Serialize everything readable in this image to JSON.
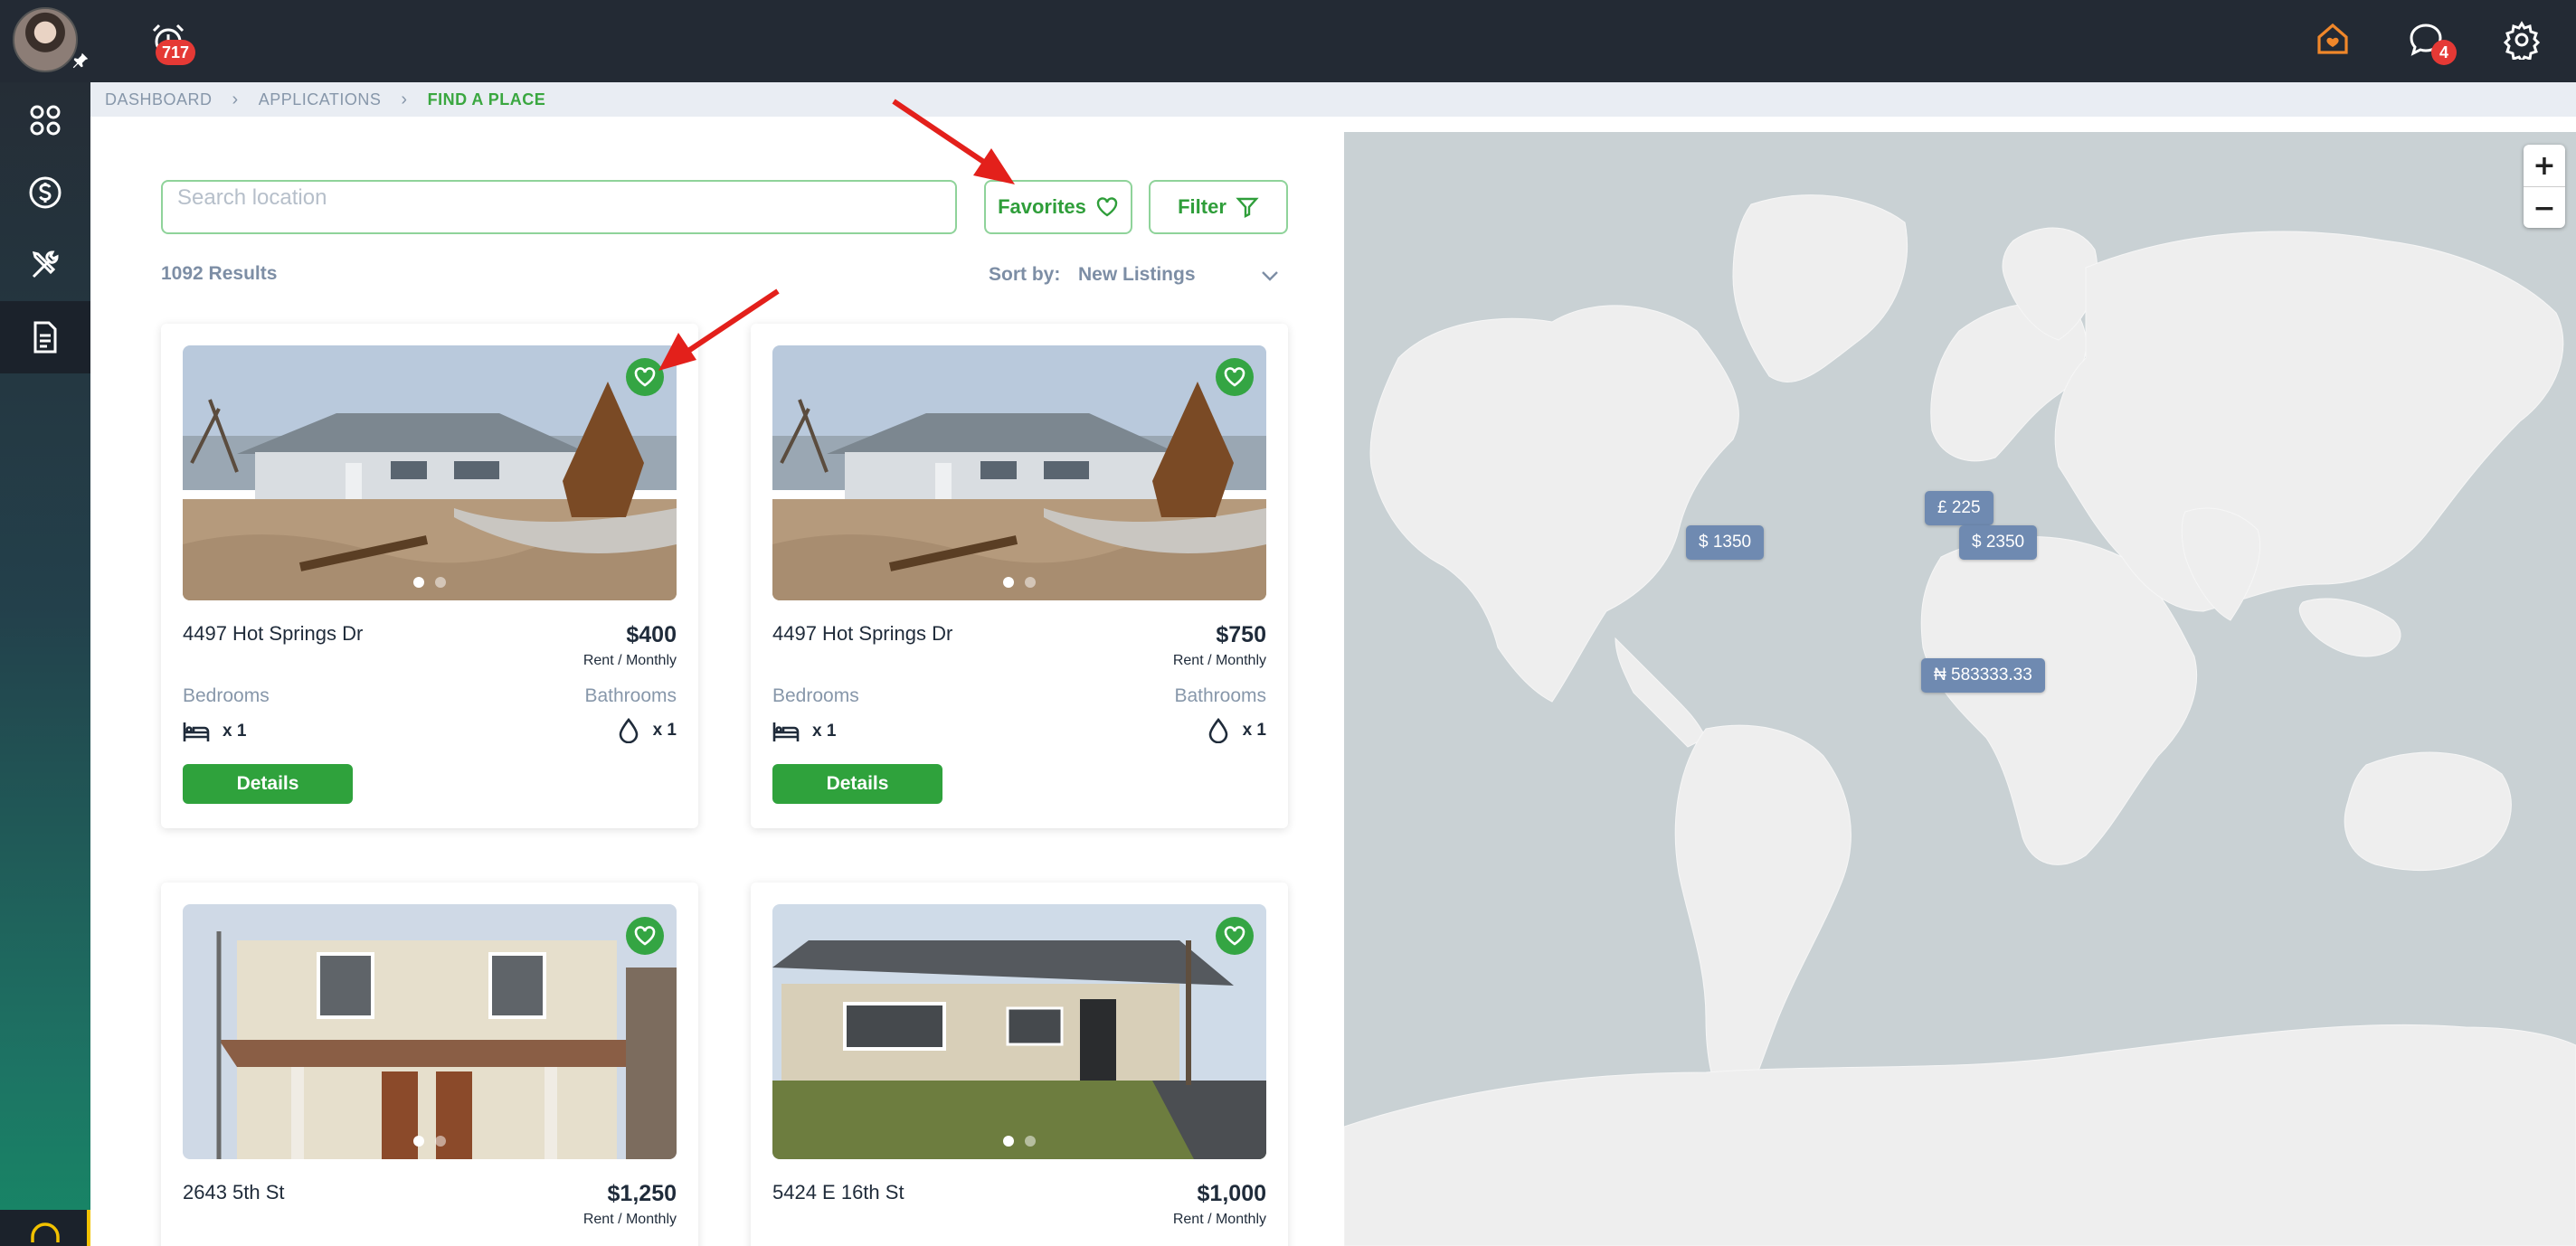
{
  "topbar": {
    "alarm_badge": "717",
    "chat_badge": "4",
    "icons": [
      "avatar",
      "alarm-clock-icon",
      "home-icon",
      "chat-icon",
      "gear-icon"
    ]
  },
  "sidebar": {
    "items": [
      {
        "name": "apps-grid-icon"
      },
      {
        "name": "dollar-icon"
      },
      {
        "name": "tools-icon"
      },
      {
        "name": "document-icon",
        "active": true
      }
    ]
  },
  "breadcrumb": {
    "items": [
      "DASHBOARD",
      "APPLICATIONS"
    ],
    "current": "FIND A PLACE"
  },
  "search": {
    "placeholder": "Search location",
    "value": ""
  },
  "controls": {
    "favorites_label": "Favorites",
    "filter_label": "Filter",
    "results": "1092 Results",
    "sort_label": "Sort by:",
    "sort_value": "New Listings"
  },
  "listings": [
    {
      "address": "4497 Hot Springs Dr",
      "price": "$400",
      "period": "Rent / Monthly",
      "bedrooms_label": "Bedrooms",
      "bathrooms_label": "Bathrooms",
      "bedrooms": "x 1",
      "bathrooms": "x 1",
      "details_label": "Details"
    },
    {
      "address": "4497 Hot Springs Dr",
      "price": "$750",
      "period": "Rent / Monthly",
      "bedrooms_label": "Bedrooms",
      "bathrooms_label": "Bathrooms",
      "bedrooms": "x 1",
      "bathrooms": "x 1",
      "details_label": "Details"
    },
    {
      "address": "2643 5th St",
      "price": "$1,250",
      "period": "Rent / Monthly"
    },
    {
      "address": "5424 E 16th St",
      "price": "$1,000",
      "period": "Rent / Monthly"
    }
  ],
  "map": {
    "zoom_in": "+",
    "zoom_out": "−",
    "markers": [
      "$ 1350",
      "£ 225",
      "$ 2350",
      "₦ 583333.33"
    ]
  },
  "colors": {
    "accent_green": "#2fa23c",
    "topbar": "#232a34",
    "marker": "#6f8ab1",
    "badge": "#e53935"
  }
}
